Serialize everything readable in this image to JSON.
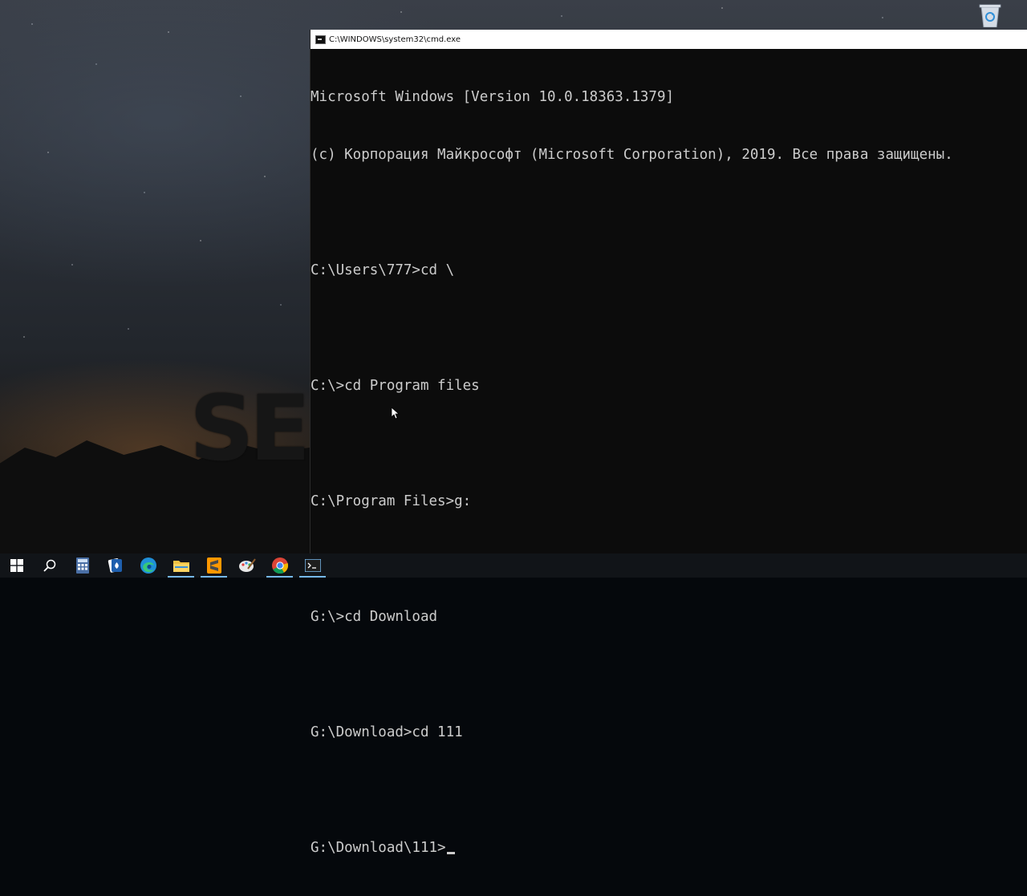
{
  "window": {
    "title": "C:\\WINDOWS\\system32\\cmd.exe"
  },
  "console": {
    "lines": [
      "Microsoft Windows [Version 10.0.18363.1379]",
      "(c) Корпорация Майкрософт (Microsoft Corporation), 2019. Все права защищены.",
      "",
      "C:\\Users\\777>cd \\",
      "",
      "C:\\>cd Program files",
      "",
      "C:\\Program Files>g:",
      "",
      "G:\\>cd Download",
      "",
      "G:\\Download>cd 111",
      "",
      "G:\\Download\\111>"
    ]
  },
  "desktop": {
    "wallpaper_logo": "SE",
    "recycle_bin_icon": "recycle-bin-icon"
  },
  "taskbar": {
    "items": [
      {
        "icon": "windows-start-icon",
        "active": false
      },
      {
        "icon": "search-icon",
        "active": false
      },
      {
        "icon": "calculator-icon",
        "active": false
      },
      {
        "icon": "solitaire-icon",
        "active": false
      },
      {
        "icon": "edge-icon",
        "active": false
      },
      {
        "icon": "file-explorer-icon",
        "active": true
      },
      {
        "icon": "sublime-text-icon",
        "active": true
      },
      {
        "icon": "paint-icon",
        "active": false
      },
      {
        "icon": "chrome-icon",
        "active": true
      },
      {
        "icon": "cmd-icon",
        "active": true
      }
    ]
  },
  "colors": {
    "console_bg": "#0c0c0c",
    "console_text": "#cccccc",
    "taskbar_bg": "#111418",
    "taskbar_active": "#76b9ed"
  }
}
